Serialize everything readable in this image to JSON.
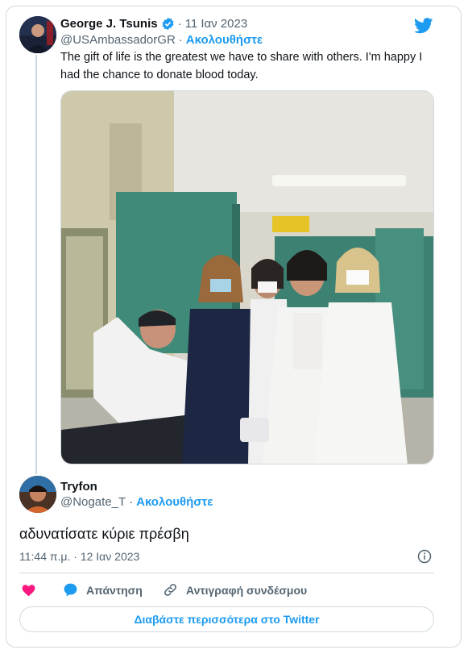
{
  "tweet": {
    "author_name": "George J. Tsunis",
    "date": "11 Ιαν 2023",
    "handle": "@USAmbassadorGR",
    "follow_label": "Ακολουθήστε",
    "text": "The gift of life is the greatest we have to share with others. I'm happy I had the chance to donate blood today.",
    "verified_icon": "verified-badge-icon"
  },
  "reply": {
    "author_name": "Tryfon",
    "handle": "@Nogate_T",
    "follow_label": "Ακολουθήστε",
    "text": "αδυνατίσατε κύριε πρέσβη",
    "timestamp": "11:44 π.μ. · 12 Ιαν 2023"
  },
  "actions": {
    "like_icon": "heart-icon",
    "reply_label": "Απάντηση",
    "copy_link_label": "Αντιγραφή συνδέσμου"
  },
  "footer": {
    "read_more_label": "Διαβάστε περισσότερα στο Twitter"
  },
  "colors": {
    "accent": "#1d9bf0",
    "like": "#f91880",
    "muted": "#536471",
    "border": "#cfd9de"
  }
}
